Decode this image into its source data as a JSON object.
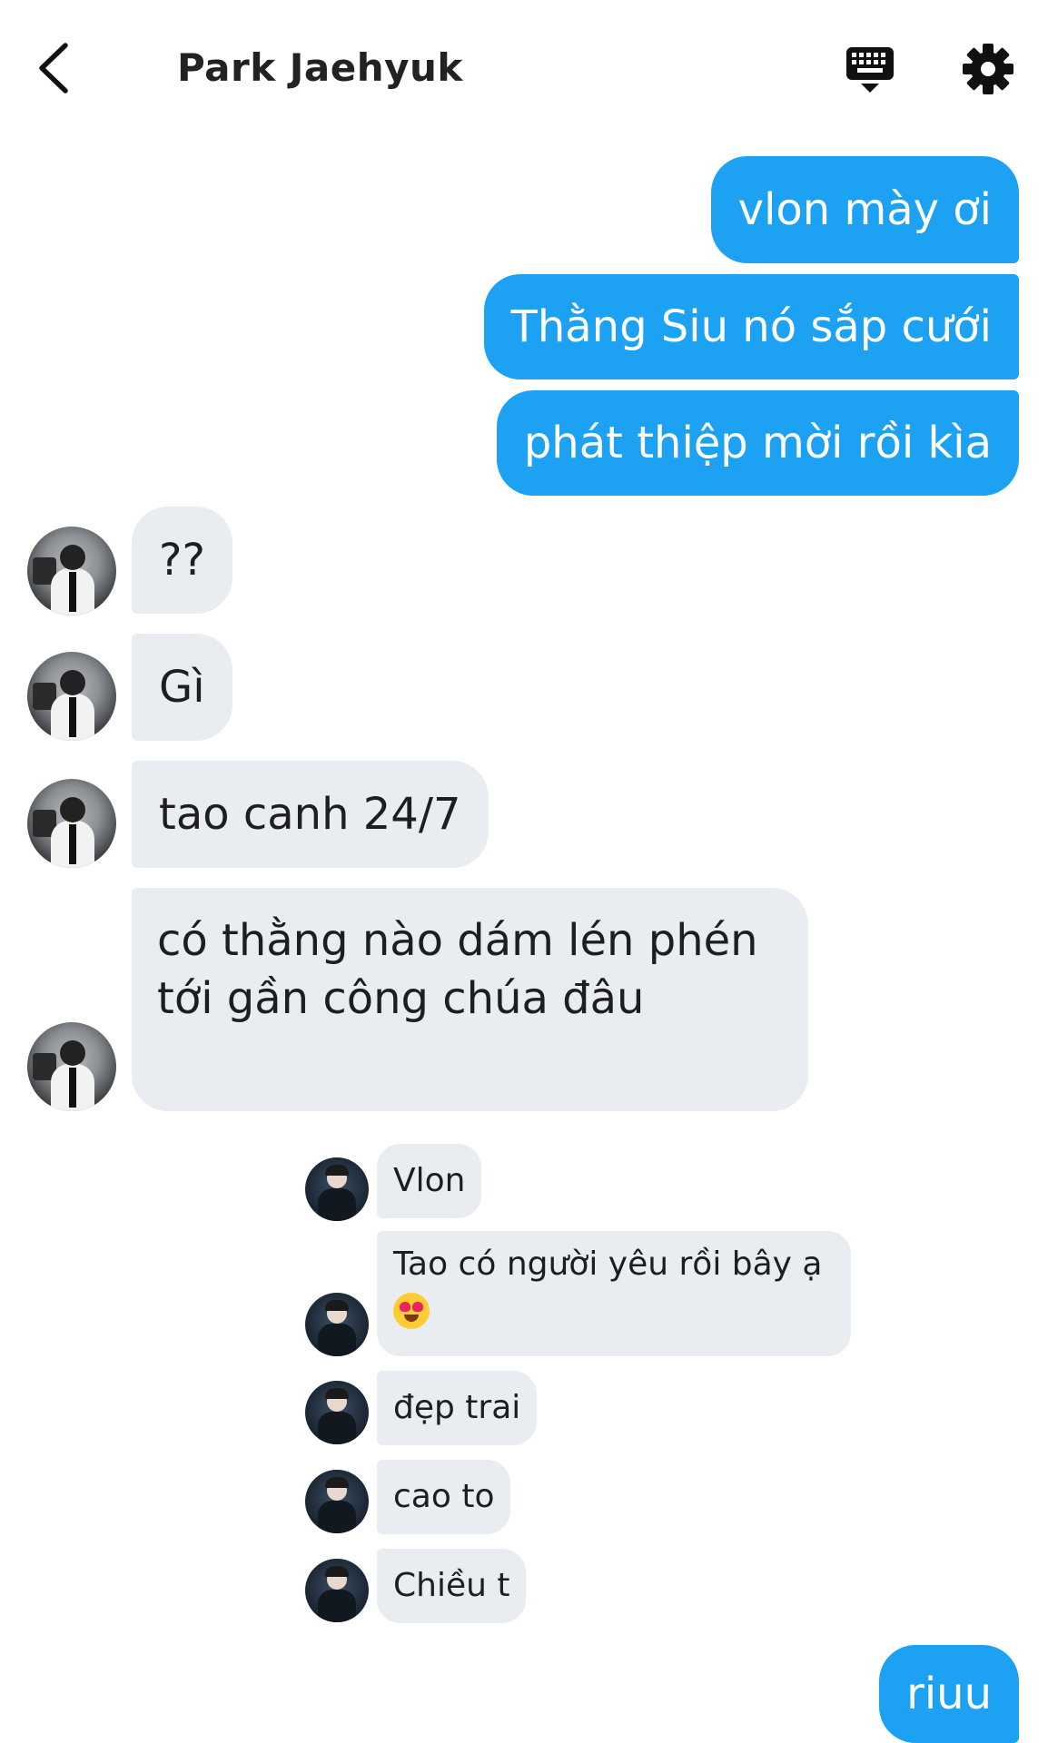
{
  "header": {
    "title": "Park Jaehyuk",
    "back_icon": "chevron-left-icon",
    "keyboard_icon": "keyboard-icon",
    "settings_icon": "gear-icon"
  },
  "colors": {
    "outgoing_bubble": "#1da1f2",
    "incoming_bubble": "#e9ecf0"
  },
  "messages": [
    {
      "dir": "out",
      "text": "vlon mày ơi"
    },
    {
      "dir": "out",
      "text": "Thằng Siu nó sắp cưới"
    },
    {
      "dir": "out",
      "text": "phát thiệp mời rồi kìa"
    },
    {
      "dir": "in",
      "text": "??"
    },
    {
      "dir": "in",
      "text": "Gì"
    },
    {
      "dir": "in",
      "text": "tao canh 24/7"
    },
    {
      "dir": "in",
      "text": "có thằng nào dám lén phén tới gần công chúa đâu"
    },
    {
      "dir": "out",
      "text": "riuu"
    }
  ],
  "quoted": [
    {
      "text": "Vlon"
    },
    {
      "text": "Tao có người yêu rồi bây ạ",
      "emoji": "heart-eyes-emoji"
    },
    {
      "text": "đẹp trai"
    },
    {
      "text": "cao to"
    },
    {
      "text": "Chiều t"
    }
  ]
}
